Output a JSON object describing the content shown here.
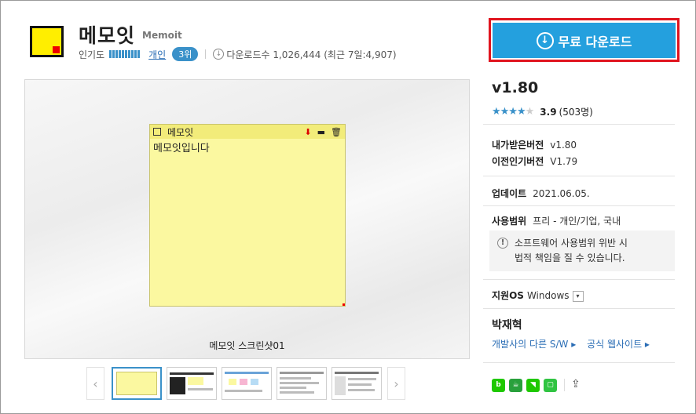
{
  "header": {
    "title": "메모잇",
    "subtitle": "Memoit",
    "popularity_label": "인기도",
    "category_link": "개인",
    "rank_badge": "3위",
    "download_count": "다운로드수 1,026,444 (최근 7일:4,907)"
  },
  "download_button": {
    "label": "무료 다운로드"
  },
  "viewer": {
    "note_title": "메모잇",
    "note_text": "메모잇입니다",
    "caption": "메모잇 스크린샷01"
  },
  "info": {
    "version": "v1.80",
    "rating": {
      "score": "3.9",
      "count": "(503명)",
      "stars": 3.9
    },
    "my_version_label": "내가받은버전",
    "my_version": "v1.80",
    "prev_version_label": "이전인기버전",
    "prev_version": "V1.79",
    "update_label": "업데이트",
    "update_date": "2021.06.05.",
    "license_label": "사용범위",
    "license_value": "프리 - 개인/기업, 국내",
    "warning_line1": "소프트웨어 사용범위 위반 시",
    "warning_line2": "법적 책임을 질 수 있습니다.",
    "os_label": "지원OS",
    "os_value": "Windows",
    "developer": "박재혁",
    "dev_other_link": "개발사의 다른 S/W ▸",
    "dev_site_link": "공식 웹사이트 ▸"
  },
  "colors": {
    "accent": "#24a0de",
    "highlight": "#e0141e",
    "note": "#fbf8a0"
  }
}
